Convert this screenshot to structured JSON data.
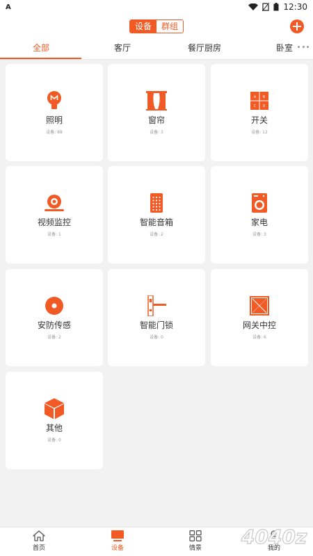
{
  "status_bar": {
    "left_icon": "A",
    "time": "12:30"
  },
  "header": {
    "segments": [
      "设备",
      "群组"
    ],
    "active_segment": 0,
    "add_icon": "plus-icon"
  },
  "tabs": {
    "items": [
      "全部",
      "客厅",
      "餐厅厨房",
      "卧室"
    ],
    "active": 0,
    "more_icon": "more-icon"
  },
  "devices": [
    {
      "name": "照明",
      "count": "设备: 88",
      "icon": "lightbulb-icon"
    },
    {
      "name": "窗帘",
      "count": "设备: 3",
      "icon": "curtain-icon"
    },
    {
      "name": "开关",
      "count": "设备: 12",
      "icon": "switch-icon"
    },
    {
      "name": "视频监控",
      "count": "设备: 1",
      "icon": "camera-icon"
    },
    {
      "name": "智能音箱",
      "count": "设备: 2",
      "icon": "speaker-icon"
    },
    {
      "name": "家电",
      "count": "设备: 3",
      "icon": "washing-machine-icon"
    },
    {
      "name": "安防传感",
      "count": "设备: 2",
      "icon": "sensor-icon"
    },
    {
      "name": "智能门锁",
      "count": "设备: 0",
      "icon": "door-lock-icon"
    },
    {
      "name": "网关中控",
      "count": "设备: 6",
      "icon": "gateway-icon"
    },
    {
      "name": "其他",
      "count": "设备: 0",
      "icon": "cube-icon"
    }
  ],
  "bottom_nav": {
    "items": [
      {
        "label": "首页",
        "icon": "home-icon"
      },
      {
        "label": "设备",
        "icon": "device-icon"
      },
      {
        "label": "情景",
        "icon": "scene-icon"
      },
      {
        "label": "我的",
        "icon": "profile-icon"
      }
    ],
    "active": 1
  },
  "watermark": "4040z",
  "colors": {
    "accent": "#f15a24",
    "background": "#f2f2f2",
    "card": "#ffffff"
  }
}
